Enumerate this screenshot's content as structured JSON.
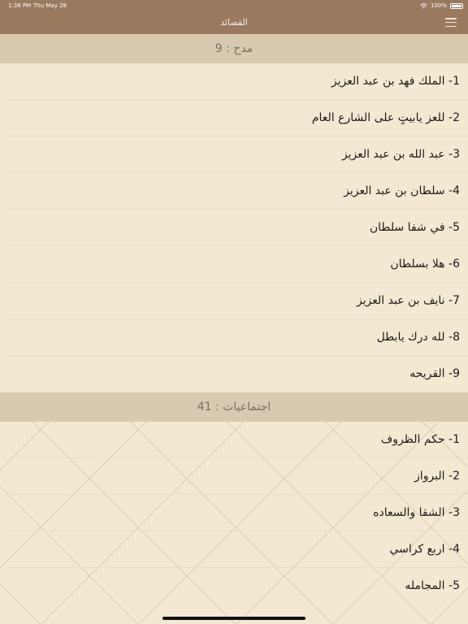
{
  "status_bar": {
    "time": "1:36 PM",
    "date": "Thu May 28",
    "battery": "100%"
  },
  "nav": {
    "title": "القصائد"
  },
  "sections": [
    {
      "header": "مدح : 9",
      "items": [
        "1- الملك فهد بن عبد العزيز",
        "2- للعز يابيتٍ على الشارع العام",
        "3- عبد الله بن عبد العزيز",
        "4- سلطان بن عبد العزيز",
        "5- في شفا سلطان",
        "6- هلا بسلطان",
        "7- نايف بن عبد العزيز",
        "8- لله درك يابطل",
        "9- القريحه"
      ]
    },
    {
      "header": "اجتماعيات : 41",
      "items": [
        "1- حكم الظروف",
        "2- البرواز",
        "3- الشقا والسعاده",
        "4- اربع كراسي",
        "5- المجامله"
      ]
    }
  ],
  "colors": {
    "navbar": "#9a7a5f",
    "background": "#f3e9d3",
    "section_header": "#d8cab0"
  },
  "icons": {
    "menu": "hamburger-menu-icon",
    "wifi": "wifi-icon",
    "battery": "battery-icon"
  }
}
